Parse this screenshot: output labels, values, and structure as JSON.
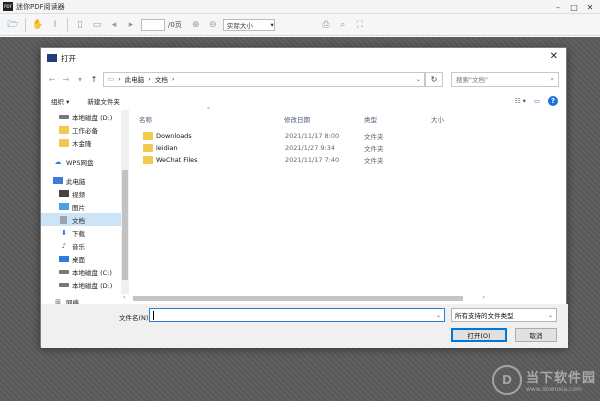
{
  "app": {
    "title": "迷你PDF阅读器",
    "logo_text": "PDF",
    "toolbar": {
      "page_total": "/0页",
      "zoom_value": "实际大小"
    }
  },
  "dialog": {
    "title": "打开",
    "address": {
      "crumbs": [
        "此电脑",
        "文档"
      ]
    },
    "search": {
      "placeholder": "搜索\"文档\""
    },
    "commands": {
      "organize": "组织 ▾",
      "new_folder": "新建文件夹"
    },
    "nav_items": [
      {
        "label": "本地磁盘 (D:)",
        "icon": "drive-icon"
      },
      {
        "label": "工作必备",
        "icon": "folder-icon"
      },
      {
        "label": "木金隆",
        "icon": "folder-icon"
      },
      {
        "label": "WPS网盘",
        "icon": "cloud-icon"
      },
      {
        "label": "此电脑",
        "icon": "computer-icon"
      },
      {
        "label": "视频",
        "icon": "video-icon"
      },
      {
        "label": "图片",
        "icon": "picture-icon"
      },
      {
        "label": "文档",
        "icon": "document-icon",
        "selected": true
      },
      {
        "label": "下载",
        "icon": "download-icon"
      },
      {
        "label": "音乐",
        "icon": "music-icon"
      },
      {
        "label": "桌面",
        "icon": "desktop-icon"
      },
      {
        "label": "本地磁盘 (C:)",
        "icon": "drive-icon"
      },
      {
        "label": "本地磁盘 (D:)",
        "icon": "drive-icon"
      },
      {
        "label": "网络",
        "icon": "network-icon"
      }
    ],
    "columns": {
      "name": "名称",
      "date": "修改日期",
      "type": "类型",
      "size": "大小"
    },
    "files": [
      {
        "name": "Downloads",
        "date": "2021/11/17 8:00",
        "type": "文件夹"
      },
      {
        "name": "leidian",
        "date": "2021/1/27 9:34",
        "type": "文件夹"
      },
      {
        "name": "WeChat Files",
        "date": "2021/11/17 7:40",
        "type": "文件夹"
      }
    ],
    "footer": {
      "filename_label": "文件名(N):",
      "filename_value": "",
      "filetype_value": "所有支持的文件类型",
      "open_button": "打开(O)",
      "cancel_button": "取消"
    }
  },
  "watermark": {
    "main": "当下软件园",
    "sub": "www.downxia.com"
  }
}
